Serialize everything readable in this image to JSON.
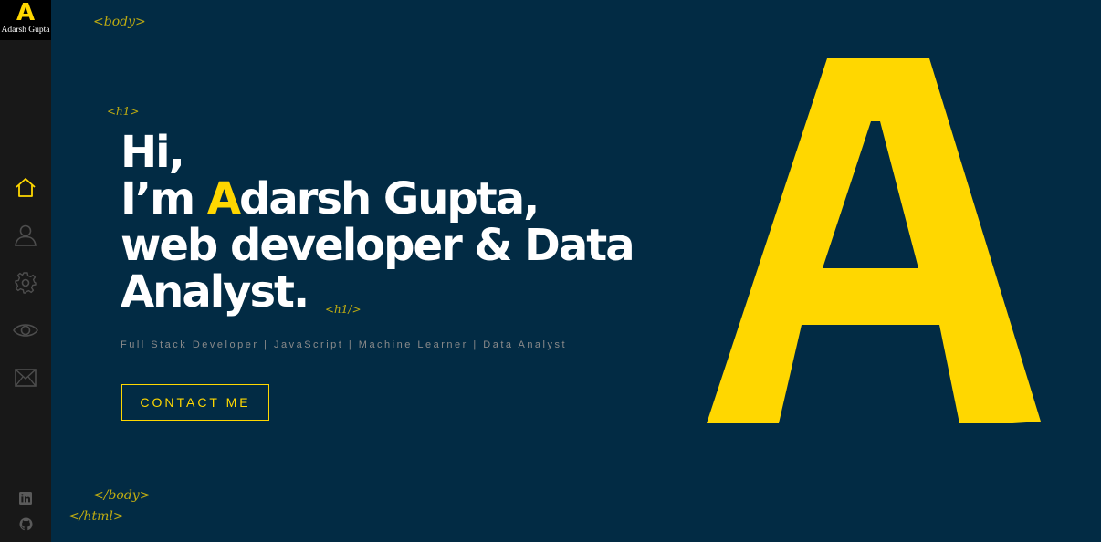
{
  "brand": {
    "logo_letter": "A",
    "logo_name": "Adarsh Gupta",
    "accent_color": "#ffd700",
    "background_color": "#022b44"
  },
  "sidebar": {
    "nav_items": [
      {
        "id": "home",
        "icon": "home-icon",
        "active": true
      },
      {
        "id": "about",
        "icon": "user-icon",
        "active": false
      },
      {
        "id": "skills",
        "icon": "gear-icon",
        "active": false
      },
      {
        "id": "work",
        "icon": "eye-icon",
        "active": false
      },
      {
        "id": "contact",
        "icon": "envelope-icon",
        "active": false
      }
    ],
    "social_items": [
      {
        "id": "linkedin",
        "icon": "linkedin-icon"
      },
      {
        "id": "github",
        "icon": "github-icon"
      }
    ]
  },
  "tags": {
    "body_open": "<body>",
    "h1_open": "<h1>",
    "h1_close": "<h1/>",
    "body_close": "</body>",
    "html_close": "</html>"
  },
  "hero": {
    "line1": "Hi,",
    "line2_prefix": "I’m ",
    "line2_accent": "A",
    "line2_rest": "darsh Gupta,",
    "line3": "web developer & Data",
    "line4": "Analyst.",
    "subtitle": "Full Stack Developer | JavaScript | Machine Learner | Data Analyst",
    "contact_label": "CONTACT ME"
  },
  "big_logo": {
    "letter": "A"
  }
}
